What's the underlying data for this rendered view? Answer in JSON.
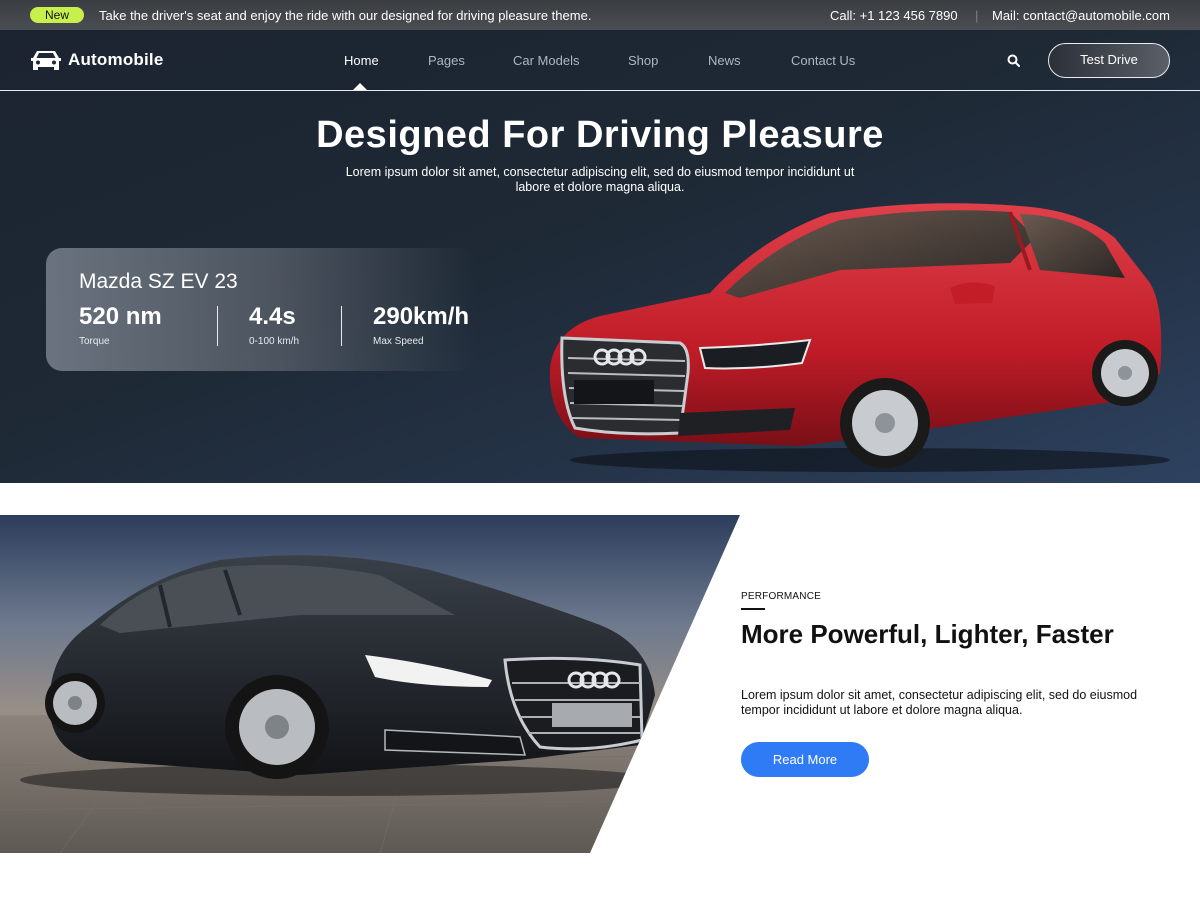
{
  "topbar": {
    "badge": "New",
    "tagline": "Take the driver's seat and enjoy the ride with our designed for driving pleasure theme.",
    "phone": "Call: +1 123 456 7890",
    "separator": "|",
    "mail": "Mail: contact@automobile.com"
  },
  "nav": {
    "brand": "Automobile",
    "items": [
      {
        "label": "Home",
        "active": true
      },
      {
        "label": "Pages"
      },
      {
        "label": "Car Models"
      },
      {
        "label": "Shop"
      },
      {
        "label": "News"
      },
      {
        "label": "Contact Us"
      }
    ],
    "cta": "Test Drive",
    "icons": {
      "logo": "car-icon",
      "search": "search-icon"
    }
  },
  "hero": {
    "title": "Designed For Driving Pleasure",
    "subtitle": "Lorem ipsum dolor sit amet, consectetur adipiscing elit, sed do eiusmod tempor incididunt ut labore et dolore magna aliqua.",
    "card": {
      "model": "Mazda SZ EV 23",
      "stats": [
        {
          "value": "520 nm",
          "label": "Torque"
        },
        {
          "value": "4.4s",
          "label": "0-100 km/h"
        },
        {
          "value": "290km/h",
          "label": "Max Speed"
        }
      ]
    }
  },
  "feature": {
    "eyebrow": "PERFORMANCE",
    "title": "More Powerful, Lighter, Faster",
    "text": "Lorem ipsum dolor sit amet, consectetur adipiscing elit, sed do eiusmod tempor incididunt ut labore et dolore magna aliqua.",
    "button": "Read More"
  },
  "colors": {
    "accent": "#2f7bf6",
    "badge": "#c8f04c",
    "hero_bg": "#1e2935",
    "car_red": "#c8202e",
    "car_dark": "#23272d"
  }
}
